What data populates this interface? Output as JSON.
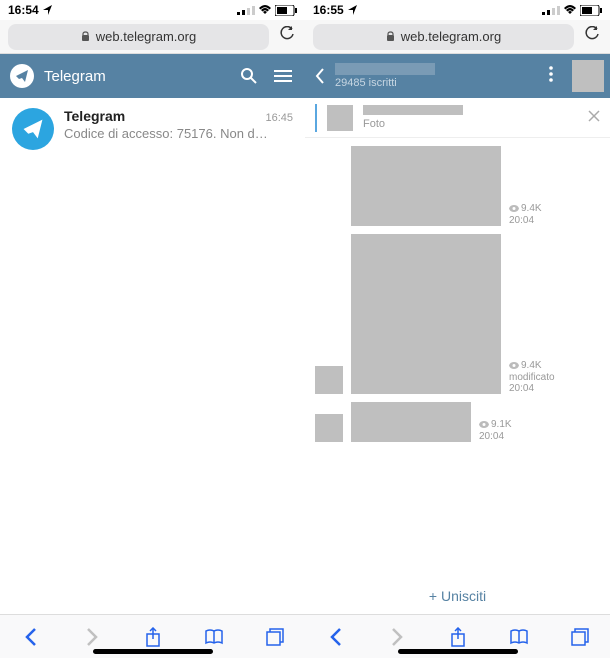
{
  "left": {
    "status_time": "16:54",
    "url": "web.telegram.org",
    "app_title": "Telegram",
    "chat": {
      "name": "Telegram",
      "time": "16:45",
      "preview": "Codice di accesso: 75176. Non d…"
    }
  },
  "right": {
    "status_time": "16:55",
    "url": "web.telegram.org",
    "subscribers": "29485 iscritti",
    "pinned_label": "Foto",
    "messages": [
      {
        "w": 150,
        "h": 80,
        "views": "9.4K",
        "time": "20:04",
        "edited": "",
        "avatar": false
      },
      {
        "w": 150,
        "h": 160,
        "views": "9.4K",
        "time": "20:04",
        "edited": "modificato",
        "avatar": true
      },
      {
        "w": 120,
        "h": 40,
        "views": "9.1K",
        "time": "20:04",
        "edited": "",
        "avatar": true
      }
    ],
    "join": "+ Unisciti"
  }
}
